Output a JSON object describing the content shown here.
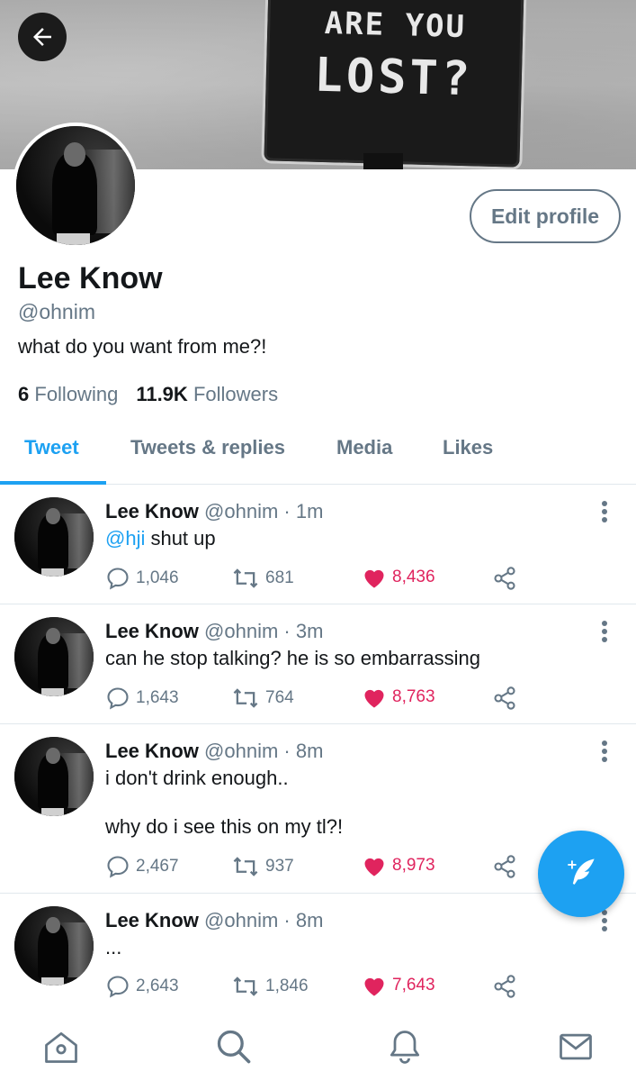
{
  "banner": {
    "sign_line1": "ARE YOU",
    "sign_line2": "LOST?"
  },
  "header": {
    "back_icon": "arrow-left-icon"
  },
  "profile": {
    "name": "Lee Know",
    "handle": "@ohnim",
    "bio": "what do you want from me?!",
    "edit_label": "Edit profile",
    "following_count": "6",
    "following_label": "Following",
    "followers_count": "11.9K",
    "followers_label": "Followers"
  },
  "tabs": [
    {
      "label": "Tweet",
      "active": true
    },
    {
      "label": "Tweets & replies",
      "active": false
    },
    {
      "label": "Media",
      "active": false
    },
    {
      "label": "Likes",
      "active": false
    }
  ],
  "tweets": [
    {
      "name": "Lee Know",
      "handle_time": "@ohnim · 1m",
      "mention": "@hji",
      "text": " shut up",
      "replies": "1,046",
      "retweets": "681",
      "likes": "8,436"
    },
    {
      "name": "Lee Know",
      "handle_time": "@ohnim · 3m",
      "mention": "",
      "text": "can he stop talking? he is so embarrassing",
      "replies": "1,643",
      "retweets": "764",
      "likes": "8,763"
    },
    {
      "name": "Lee Know",
      "handle_time": "@ohnim · 8m",
      "mention": "",
      "text": "i don't drink enough..\n\nwhy do i see this on my tl?!",
      "replies": "2,467",
      "retweets": "937",
      "likes": "8,973"
    },
    {
      "name": "Lee Know",
      "handle_time": "@ohnim · 8m",
      "mention": "",
      "text": "...",
      "replies": "2,643",
      "retweets": "1,846",
      "likes": "7,643"
    }
  ],
  "colors": {
    "accent": "#1da1f2",
    "like": "#e0245e",
    "muted": "#657786",
    "text": "#14171a"
  },
  "fab": {
    "icon": "compose-tweet-icon"
  },
  "bottom_nav": [
    {
      "icon": "home-icon"
    },
    {
      "icon": "search-icon"
    },
    {
      "icon": "notifications-bell-icon"
    },
    {
      "icon": "messages-mail-icon"
    }
  ]
}
